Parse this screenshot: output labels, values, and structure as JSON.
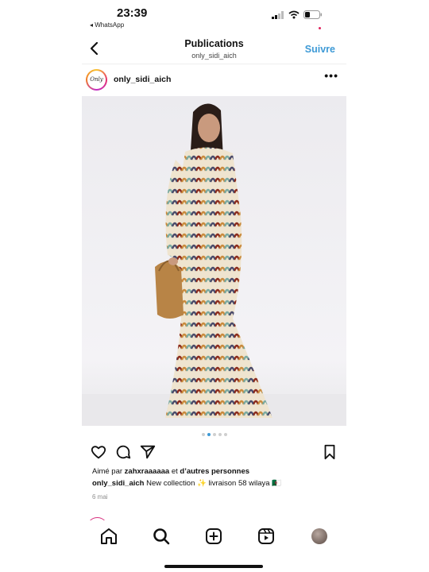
{
  "status": {
    "time": "23:39",
    "back_app": "◂ WhatsApp"
  },
  "header": {
    "title": "Publications",
    "subtitle": "only_sidi_aich",
    "follow_label": "Suivre"
  },
  "post": {
    "username": "only_sidi_aich",
    "avatar_text": "Only",
    "more_label": "•••",
    "carousel": {
      "total": 5,
      "active_index": 1
    },
    "likes_prefix": "Aimé par ",
    "likes_user": "zahxraaaaaa",
    "likes_mid": " et ",
    "likes_rest": "d’autres personnes",
    "caption_user": "only_sidi_aich",
    "caption_text": " New collection ✨ livraison 58 wilaya 🇩🇿",
    "date": "6 mai"
  },
  "icons": {
    "back": "chevron-left-icon",
    "like": "heart-icon",
    "comment": "comment-icon",
    "share": "send-icon",
    "save": "bookmark-icon",
    "tabs": [
      "home-icon",
      "search-icon",
      "create-icon",
      "reels-icon",
      "profile-avatar"
    ]
  },
  "colors": {
    "accent": "#3e9ad6",
    "notification": "#e0245e"
  }
}
